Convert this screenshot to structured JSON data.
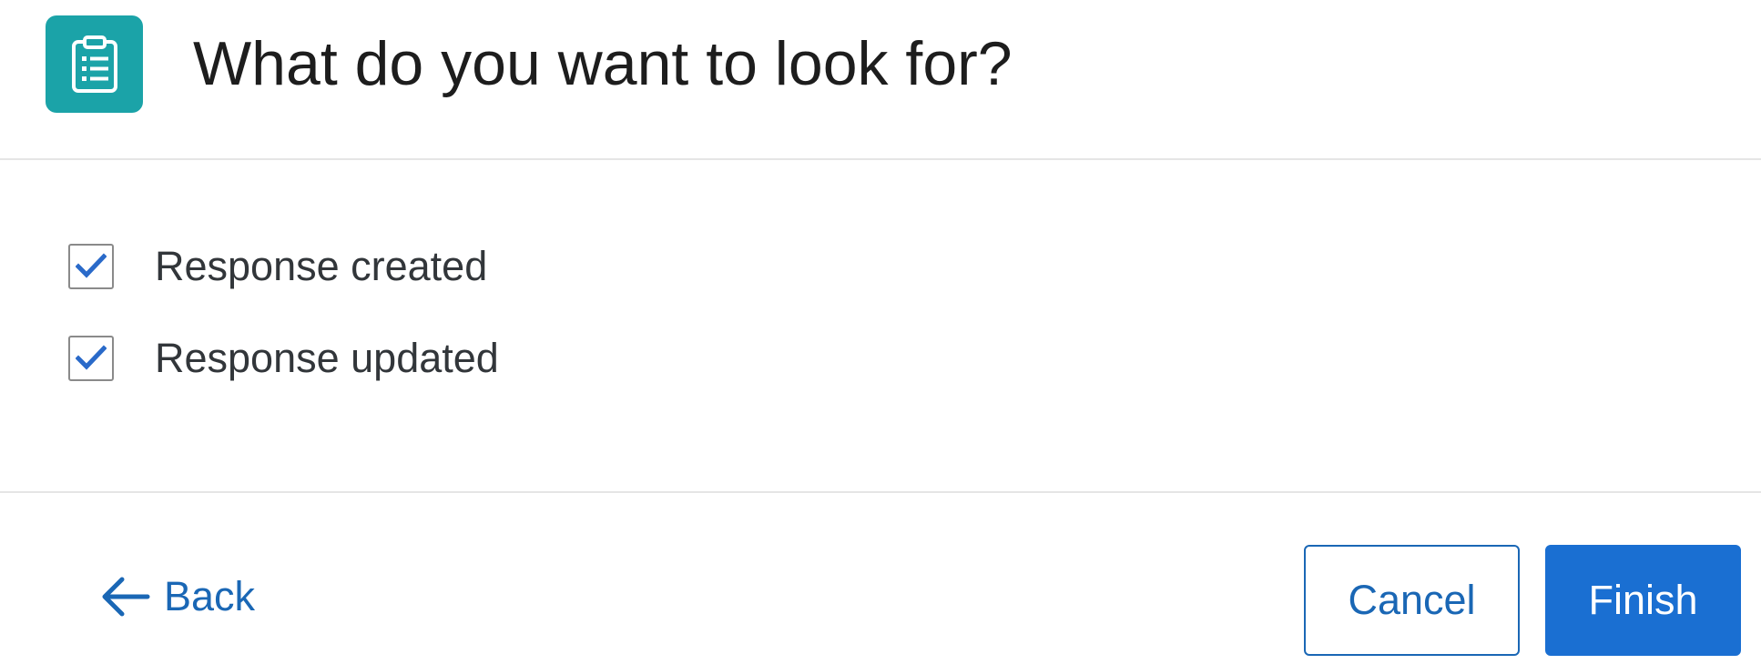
{
  "header": {
    "title": "What do you want to look for?",
    "icon": "clipboard-list-icon",
    "icon_color": "#1ba3a8"
  },
  "options": [
    {
      "label": "Response created",
      "checked": true
    },
    {
      "label": "Response updated",
      "checked": true
    }
  ],
  "footer": {
    "back_label": "Back",
    "cancel_label": "Cancel",
    "finish_label": "Finish"
  },
  "colors": {
    "accent": "#1a6fd2",
    "link": "#1a67b5",
    "checkmark": "#2a6ac9"
  }
}
